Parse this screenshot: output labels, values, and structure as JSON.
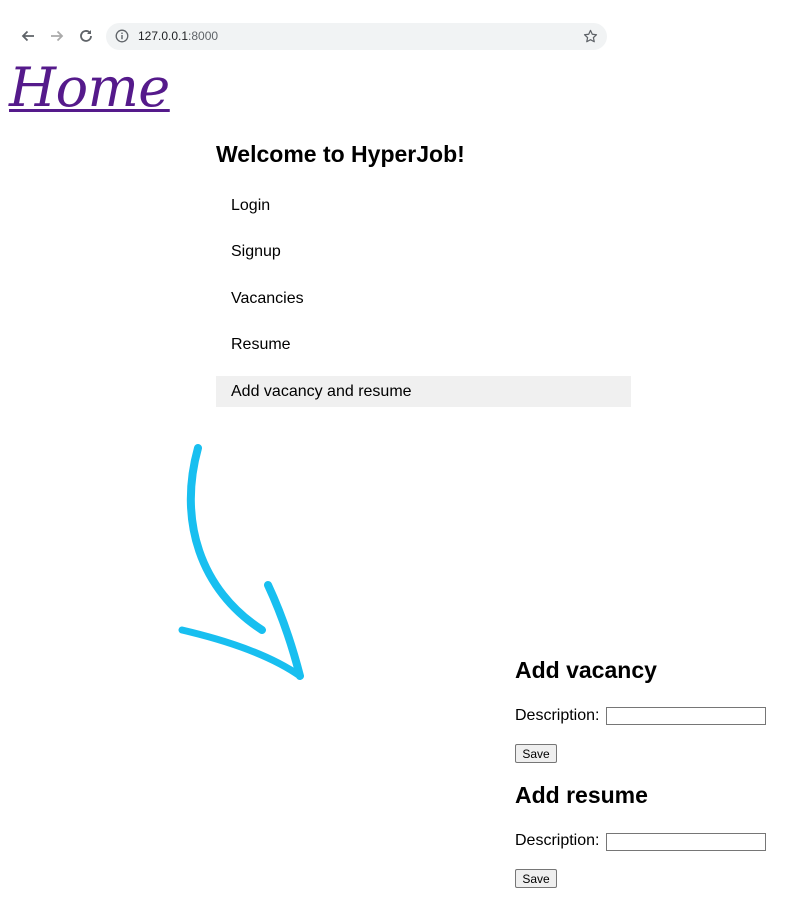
{
  "browser": {
    "url_host": "127.0.0.1",
    "url_port": ":8000"
  },
  "page": {
    "home_link": "Home",
    "welcome": "Welcome to HyperJob!",
    "menu": [
      {
        "label": "Login"
      },
      {
        "label": "Signup"
      },
      {
        "label": "Vacancies"
      },
      {
        "label": "Resume"
      },
      {
        "label": "Add vacancy and resume",
        "highlighted": true
      }
    ]
  },
  "forms": {
    "vacancy": {
      "title": "Add vacancy",
      "label": "Description:",
      "value": "",
      "save_label": "Save"
    },
    "resume": {
      "title": "Add resume",
      "label": "Description:",
      "value": "",
      "save_label": "Save"
    }
  },
  "colors": {
    "link_visited": "#551a8b",
    "arrow": "#18bff0",
    "highlight": "#f0f0f0"
  }
}
